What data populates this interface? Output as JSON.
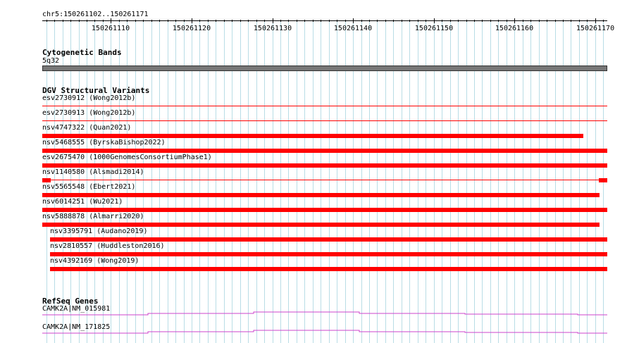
{
  "ruler": {
    "location": "chr5:150261102..150261171",
    "start": 150261102,
    "end": 150261171,
    "tick_labels": [
      "150261110",
      "150261120",
      "150261130",
      "150261140",
      "150261150",
      "150261160",
      "150261170"
    ]
  },
  "cytoband": {
    "title": "Cytogenetic Bands",
    "band_name": "5q32",
    "color": "#777777"
  },
  "dgv": {
    "title": "DGV Structural Variants",
    "color": "#ff0000",
    "items": [
      {
        "label": "esv2730912 (Wong2012b)",
        "level": 0,
        "feature": "line",
        "segments": [
          [
            0.0,
            1.0
          ]
        ]
      },
      {
        "label": "esv2730913 (Wong2012b)",
        "level": 0,
        "feature": "line",
        "segments": [
          [
            0.0,
            1.0
          ]
        ]
      },
      {
        "label": "nsv4747322 (Quan2021)",
        "level": 0,
        "feature": "bar",
        "segments": [
          [
            0.0,
            0.957
          ]
        ]
      },
      {
        "label": "nsv5468555 (ByrskaBishop2022)",
        "level": 0,
        "feature": "bar",
        "segments": [
          [
            0.0,
            1.0
          ]
        ]
      },
      {
        "label": "esv2675470 (1000GenomesConsortiumPhase1)",
        "level": 0,
        "feature": "bar",
        "segments": [
          [
            0.0,
            1.0
          ]
        ]
      },
      {
        "label": "nsv1140580 (Alsmadi2014)",
        "level": 0,
        "feature": "split",
        "segments": [
          [
            0.0,
            0.015
          ],
          [
            0.985,
            1.0
          ]
        ]
      },
      {
        "label": "nsv5565548 (Ebert2021)",
        "level": 0,
        "feature": "bar",
        "segments": [
          [
            0.0,
            0.986
          ]
        ]
      },
      {
        "label": "nsv6014251 (Wu2021)",
        "level": 0,
        "feature": "bar",
        "segments": [
          [
            0.0,
            1.0
          ]
        ]
      },
      {
        "label": "nsv5888878 (Almarri2020)",
        "level": 0,
        "feature": "bar",
        "segments": [
          [
            0.0,
            0.986
          ]
        ]
      },
      {
        "label": "nsv3395791 (Audano2019)",
        "level": 1,
        "feature": "bar",
        "segments": [
          [
            0.014,
            1.0
          ]
        ]
      },
      {
        "label": "nsv2810557 (Huddleston2016)",
        "level": 1,
        "feature": "bar",
        "segments": [
          [
            0.014,
            1.0
          ]
        ]
      },
      {
        "label": "nsv4392169 (Wong2019)",
        "level": 1,
        "feature": "bar",
        "segments": [
          [
            0.014,
            1.0
          ]
        ]
      }
    ]
  },
  "refseq": {
    "title": "RefSeq Genes",
    "color": "#cc44cc",
    "genes": [
      {
        "label": "CAMK2A|NM_015981"
      },
      {
        "label": "CAMK2A|NM_171825"
      }
    ]
  }
}
